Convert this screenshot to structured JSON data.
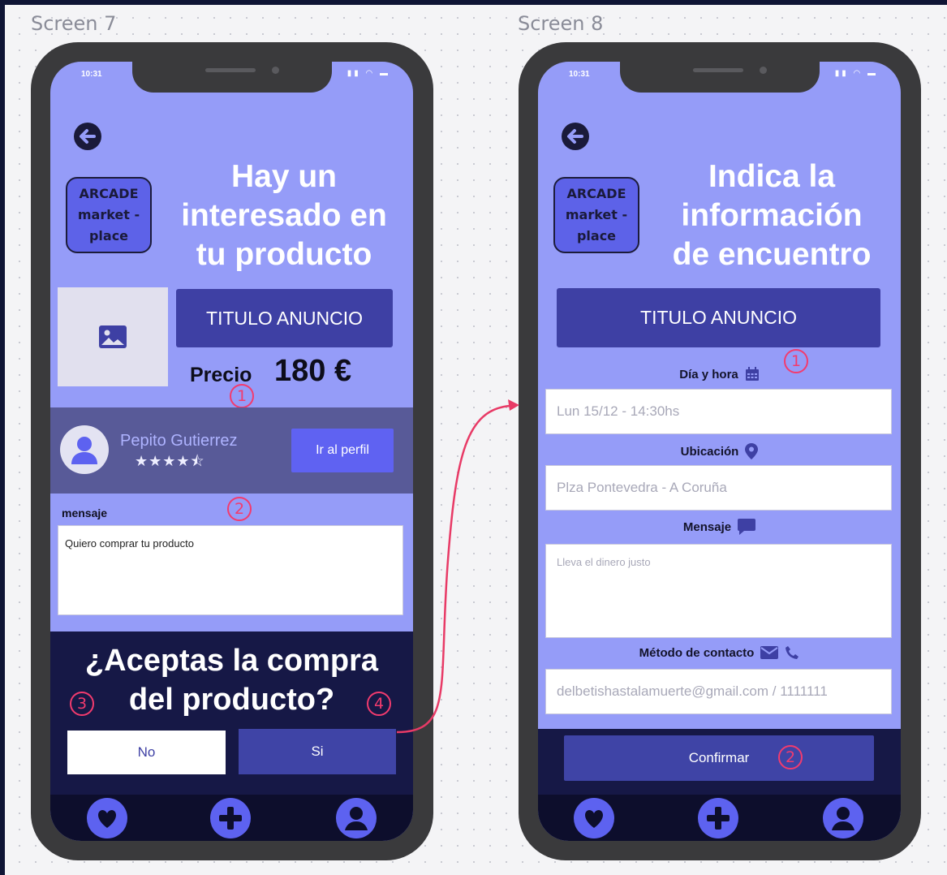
{
  "screens": [
    {
      "label": "Screen 7",
      "status_time": "10:31",
      "logo": [
        "ARCADE",
        "market -",
        "place"
      ],
      "headline": [
        "Hay un",
        "interesado en",
        "tu producto"
      ],
      "ad_title": "TITULO ANUNCIO",
      "price_label": "Precio",
      "price_value": "180 €",
      "user_name": "Pepito Gutierrez",
      "rating_stars": 4.5,
      "rating_text": "★★★★⯪",
      "profile_button": "Ir al perfil",
      "message_label": "mensaje",
      "message_text": "Quiero comprar tu producto",
      "question": [
        "¿Aceptas la compra",
        "del producto?"
      ],
      "no_button": "No",
      "yes_button": "Si",
      "markers": [
        "1",
        "2",
        "3",
        "4"
      ]
    },
    {
      "label": "Screen 8",
      "status_time": "10:31",
      "logo": [
        "ARCADE",
        "market -",
        "place"
      ],
      "headline": [
        "Indica la",
        "información",
        "de encuentro"
      ],
      "ad_title": "TITULO ANUNCIO",
      "date_label": "Día y hora",
      "date_value": "Lun 15/12 - 14:30hs",
      "location_label": "Ubicación",
      "location_value": "Plza Pontevedra - A Coruña",
      "message_label": "Mensaje",
      "message_value": "Lleva el dinero justo",
      "contact_label": "Método de contacto",
      "contact_value": "delbetishastalamuerte@gmail.com / 1111111",
      "confirm_button": "Confirmar",
      "markers": [
        "1",
        "2"
      ]
    }
  ],
  "nav_icons": [
    "heart-icon",
    "plus-circle-icon",
    "user-circle-icon"
  ],
  "colors": {
    "screen_bg": "#959cf8",
    "accent_dark": "#3e40a4",
    "panel_dark": "#161846",
    "nav_bg": "#0d0e2c",
    "button_blue": "#5f62f2",
    "marker": "#f23b6e",
    "icon_blue": "#5d62f0"
  }
}
